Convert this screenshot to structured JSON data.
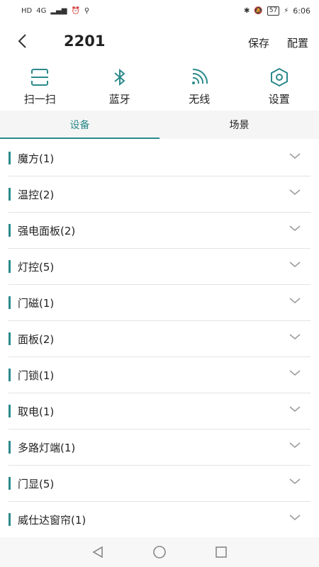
{
  "status": {
    "network": "4G",
    "time": "6:06",
    "battery": "57"
  },
  "header": {
    "title": "2201",
    "save": "保存",
    "config": "配置"
  },
  "tools": [
    {
      "label": "扫一扫",
      "icon": "scan-icon"
    },
    {
      "label": "蓝牙",
      "icon": "bluetooth-icon"
    },
    {
      "label": "无线",
      "icon": "wireless-icon"
    },
    {
      "label": "设置",
      "icon": "settings-icon"
    }
  ],
  "tabs": [
    {
      "label": "设备",
      "active": true
    },
    {
      "label": "场景",
      "active": false
    }
  ],
  "devices": [
    {
      "name": "魔方(1)"
    },
    {
      "name": "温控(2)"
    },
    {
      "name": "强电面板(2)"
    },
    {
      "name": "灯控(5)"
    },
    {
      "name": "门磁(1)"
    },
    {
      "name": "面板(2)"
    },
    {
      "name": "门锁(1)"
    },
    {
      "name": "取电(1)"
    },
    {
      "name": "多路灯端(1)"
    },
    {
      "name": "门显(5)"
    },
    {
      "name": "威仕达窗帘(1)"
    }
  ],
  "colors": {
    "accent": "#2c8a8c"
  }
}
